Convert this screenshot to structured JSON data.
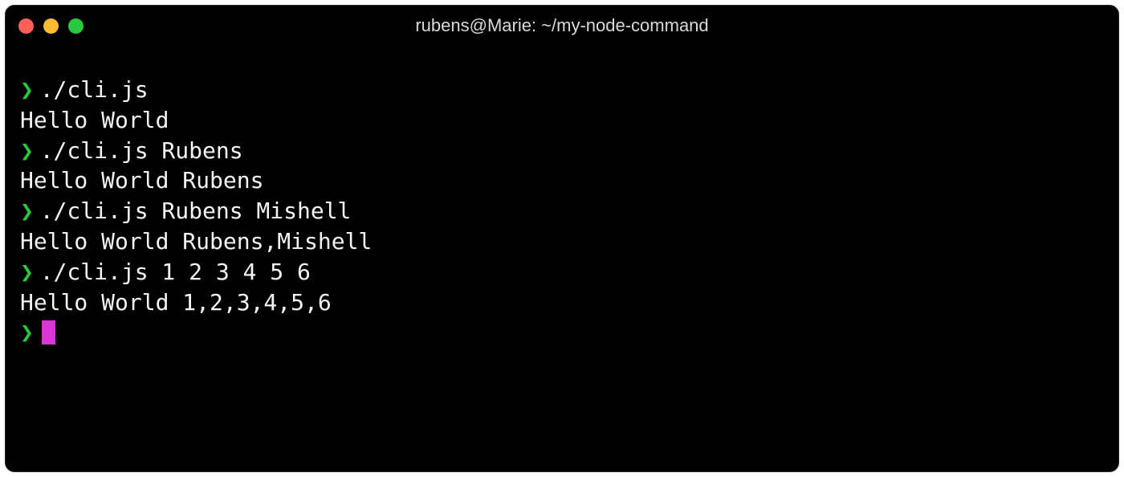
{
  "window": {
    "title": "rubens@Marie: ~/my-node-command"
  },
  "colors": {
    "traffic_red": "#ff5f57",
    "traffic_yellow": "#febc2e",
    "traffic_green": "#28c840",
    "prompt": "#28c840",
    "cursor": "#d837d8",
    "text": "#f4f4f4",
    "bg": "#000000"
  },
  "prompt_symbol": "❯",
  "session": [
    {
      "type": "command",
      "text": "./cli.js"
    },
    {
      "type": "output",
      "text": "Hello World"
    },
    {
      "type": "command",
      "text": "./cli.js Rubens"
    },
    {
      "type": "output",
      "text": "Hello World Rubens"
    },
    {
      "type": "command",
      "text": "./cli.js Rubens Mishell"
    },
    {
      "type": "output",
      "text": "Hello World Rubens,Mishell"
    },
    {
      "type": "command",
      "text": "./cli.js 1 2 3 4 5 6"
    },
    {
      "type": "output",
      "text": "Hello World 1,2,3,4,5,6"
    },
    {
      "type": "prompt",
      "text": ""
    }
  ]
}
